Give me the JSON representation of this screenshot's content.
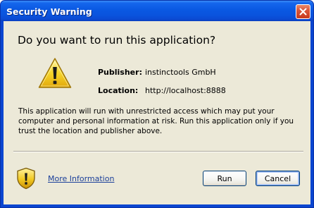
{
  "window": {
    "title": "Security Warning"
  },
  "dialog": {
    "headline": "Do you want to run this application?",
    "publisher_label": "Publisher:",
    "publisher_value": "instinctools GmbH",
    "location_label": "Location:",
    "location_value": "http://localhost:8888",
    "description": "This application will run with unrestricted access which may put your computer and personal information at risk. Run this application only if you trust the location and publisher above.",
    "more_info_link": "More Information"
  },
  "buttons": {
    "run_label": "Run",
    "cancel_label": "Cancel"
  },
  "icons": {
    "warning": "warning-triangle-icon",
    "shield": "security-shield-icon",
    "close": "close-icon"
  },
  "colors": {
    "title_bar": "#0a54de",
    "close_button": "#d9553a",
    "dialog_background": "#ece9d8",
    "warning_yellow": "#f6d52a",
    "link": "#1a3f9a"
  }
}
